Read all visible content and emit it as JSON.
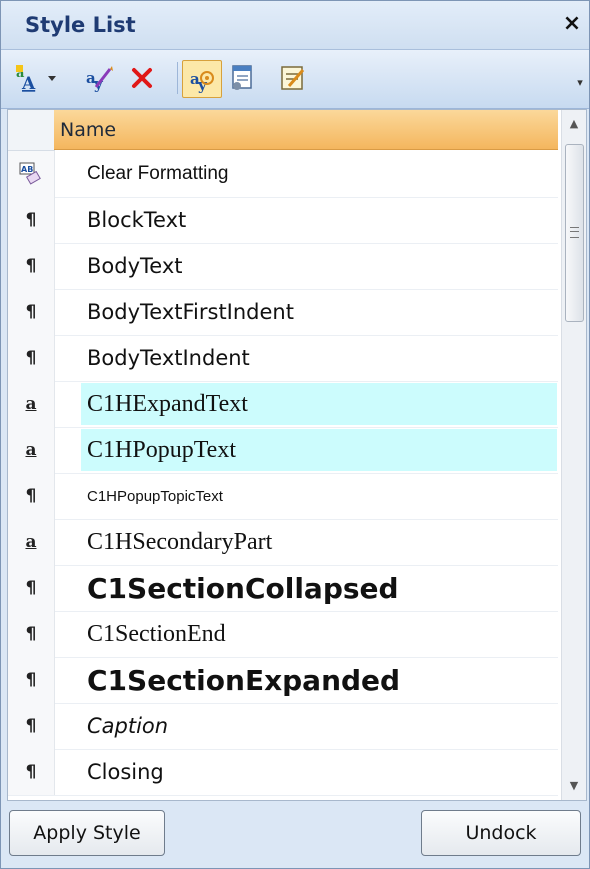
{
  "panel": {
    "title": "Style List",
    "close_label": "×"
  },
  "toolbar": {
    "icons": [
      "new-style-icon",
      "dropdown-arrow-icon",
      "modify-style-icon",
      "delete-style-icon",
      "show-styles-icon",
      "style-settings-icon",
      "style-sheet-icon"
    ],
    "overflow_label": "▾"
  },
  "grid": {
    "column_header": "Name",
    "rows": [
      {
        "indicator": "",
        "name": "Clear Formatting",
        "style": "clear",
        "highlight": false,
        "icon": "clear-formatting-icon"
      },
      {
        "indicator": "¶",
        "name": "BlockText",
        "style": "sans",
        "highlight": false
      },
      {
        "indicator": "¶",
        "name": "BodyText",
        "style": "sans",
        "highlight": false
      },
      {
        "indicator": "¶",
        "name": "BodyTextFirstIndent",
        "style": "sans",
        "highlight": false
      },
      {
        "indicator": "¶",
        "name": "BodyTextIndent",
        "style": "sans",
        "highlight": false
      },
      {
        "indicator": "a",
        "name": "C1HExpandText",
        "style": "serif",
        "highlight": true
      },
      {
        "indicator": "a",
        "name": "C1HPopupText",
        "style": "serif",
        "highlight": true
      },
      {
        "indicator": "¶",
        "name": "C1HPopupTopicText",
        "style": "small",
        "highlight": false
      },
      {
        "indicator": "a",
        "name": "C1HSecondaryPart",
        "style": "serif",
        "highlight": false
      },
      {
        "indicator": "¶",
        "name": "C1SectionCollapsed",
        "style": "bold",
        "highlight": false
      },
      {
        "indicator": "¶",
        "name": "C1SectionEnd",
        "style": "serif",
        "highlight": false
      },
      {
        "indicator": "¶",
        "name": "C1SectionExpanded",
        "style": "bold",
        "highlight": false
      },
      {
        "indicator": "¶",
        "name": "Caption",
        "style": "italic",
        "highlight": false
      },
      {
        "indicator": "¶",
        "name": "Closing",
        "style": "sans",
        "highlight": false
      }
    ]
  },
  "buttons": {
    "apply_label": "Apply Style",
    "undock_label": "Undock"
  },
  "colors": {
    "title_text": "#1f3b73",
    "header_orange": "#f4b65e",
    "highlight_cyan": "#ccfcfd",
    "delete_red": "#e01818"
  }
}
